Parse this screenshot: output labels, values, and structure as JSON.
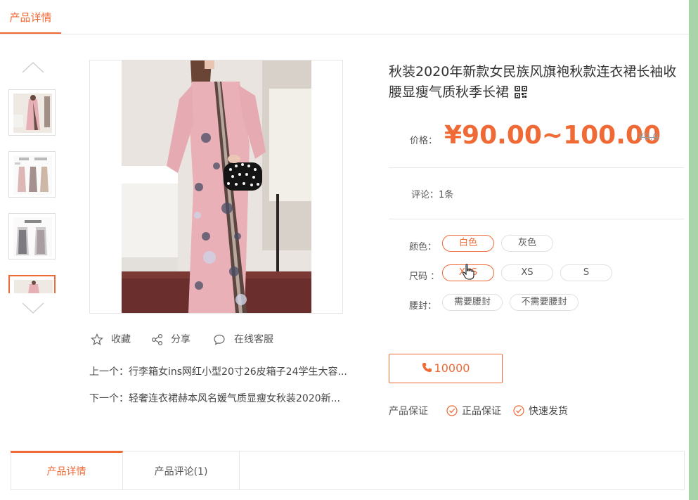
{
  "top_tab": {
    "label": "产品详情"
  },
  "product": {
    "title": "秋装2020年新款女民族风旗袍秋款连衣裙长袖收腰显瘦气质秋季长裙",
    "price_label": "价格：",
    "price": "¥90.00~100.00",
    "old_price": "¥0.0",
    "comments_label": "评论：",
    "comments_value": "1条",
    "color_label": "颜色：",
    "colors": [
      "白色",
      "灰色"
    ],
    "selected_color": "白色",
    "size_label": "尺码",
    "sizes": [
      "XXS",
      "XS",
      "S"
    ],
    "selected_size": "XXS",
    "waist_label": "腰封：",
    "waists": [
      "需要腰封",
      "不需要腰封"
    ],
    "phone": "10000",
    "guarantee_label": "产品保证",
    "guarantees": [
      "正品保证",
      "快速发货"
    ]
  },
  "actions": {
    "favorite": "收藏",
    "share": "分享",
    "service": "在线客服"
  },
  "nav": {
    "prev_label": "上一个：",
    "prev": "行李箱女ins网红小型20寸26皮箱子24学生大容...",
    "next_label": "下一个：",
    "next": "轻奢连衣裙赫本风名媛气质显瘦女秋装2020新..."
  },
  "bottom_tabs": [
    {
      "label": "产品详情",
      "active": true
    },
    {
      "label": "产品评论(1)",
      "active": false
    }
  ],
  "colors": {
    "accent": "#f06a35",
    "dress": "#e9b0b8",
    "page_bg": "#a8d5a8"
  }
}
